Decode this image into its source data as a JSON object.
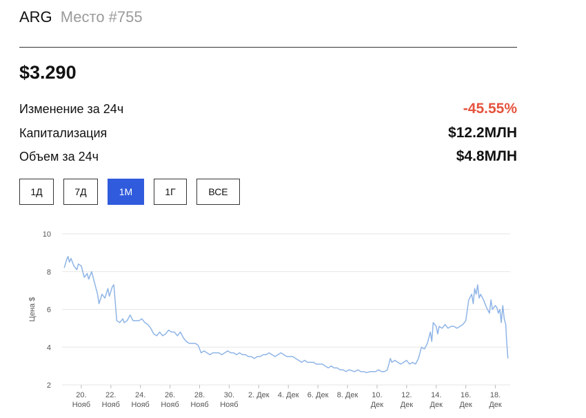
{
  "header": {
    "ticker": "ARG",
    "rank": "Место #755"
  },
  "price": "$3.290",
  "stats": [
    {
      "label": "Изменение за 24ч",
      "value": "-45.55%",
      "negative": true
    },
    {
      "label": "Капитализация",
      "value": "$12.2МЛН",
      "negative": false
    },
    {
      "label": "Объем за 24ч",
      "value": "$4.8МЛН",
      "negative": false
    }
  ],
  "periods": [
    {
      "label": "1Д",
      "active": false
    },
    {
      "label": "7Д",
      "active": false
    },
    {
      "label": "1М",
      "active": true
    },
    {
      "label": "1Г",
      "active": false
    },
    {
      "label": "ВСЕ",
      "active": false
    }
  ],
  "colors": {
    "accent": "#2f5bdc",
    "negative": "#e5533d",
    "line": "#8eb4e6"
  },
  "chart_data": {
    "type": "line",
    "ylabel": "Цена $",
    "ylim": [
      2,
      10
    ],
    "yticks": [
      2,
      4,
      6,
      8,
      10
    ],
    "xlim": [
      18.7,
      49.0
    ],
    "xticks": [
      {
        "x": 20,
        "l1": "20.",
        "l2": "Нояб"
      },
      {
        "x": 22,
        "l1": "22.",
        "l2": "Нояб"
      },
      {
        "x": 24,
        "l1": "24.",
        "l2": "Нояб"
      },
      {
        "x": 26,
        "l1": "26.",
        "l2": "Нояб"
      },
      {
        "x": 28,
        "l1": "28.",
        "l2": "Нояб"
      },
      {
        "x": 30,
        "l1": "30.",
        "l2": "Нояб"
      },
      {
        "x": 32,
        "l1": "2. Дек",
        "l2": ""
      },
      {
        "x": 34,
        "l1": "4. Дек",
        "l2": ""
      },
      {
        "x": 36,
        "l1": "6. Дек",
        "l2": ""
      },
      {
        "x": 38,
        "l1": "8. Дек",
        "l2": ""
      },
      {
        "x": 40,
        "l1": "10.",
        "l2": "Дек"
      },
      {
        "x": 42,
        "l1": "12.",
        "l2": "Дек"
      },
      {
        "x": 44,
        "l1": "14.",
        "l2": "Дек"
      },
      {
        "x": 46,
        "l1": "16.",
        "l2": "Дек"
      },
      {
        "x": 48,
        "l1": "18.",
        "l2": "Дек"
      }
    ],
    "series": [
      {
        "points": [
          [
            18.85,
            8.2
          ],
          [
            19.0,
            8.6
          ],
          [
            19.1,
            8.8
          ],
          [
            19.2,
            8.5
          ],
          [
            19.3,
            8.7
          ],
          [
            19.5,
            8.3
          ],
          [
            19.7,
            8.1
          ],
          [
            19.8,
            8.4
          ],
          [
            20.0,
            8.3
          ],
          [
            20.2,
            7.7
          ],
          [
            20.4,
            7.9
          ],
          [
            20.5,
            7.6
          ],
          [
            20.7,
            8.0
          ],
          [
            20.9,
            7.4
          ],
          [
            21.1,
            6.8
          ],
          [
            21.2,
            6.3
          ],
          [
            21.4,
            6.8
          ],
          [
            21.6,
            6.6
          ],
          [
            21.8,
            7.1
          ],
          [
            21.9,
            6.7
          ],
          [
            22.1,
            7.2
          ],
          [
            22.2,
            7.3
          ],
          [
            22.4,
            5.4
          ],
          [
            22.6,
            5.3
          ],
          [
            22.8,
            5.5
          ],
          [
            22.9,
            5.3
          ],
          [
            23.1,
            5.4
          ],
          [
            23.3,
            5.7
          ],
          [
            23.5,
            5.4
          ],
          [
            23.7,
            5.4
          ],
          [
            23.9,
            5.4
          ],
          [
            24.1,
            5.5
          ],
          [
            24.3,
            5.3
          ],
          [
            24.5,
            5.2
          ],
          [
            24.7,
            5.0
          ],
          [
            24.9,
            4.7
          ],
          [
            25.1,
            4.6
          ],
          [
            25.3,
            4.8
          ],
          [
            25.5,
            4.6
          ],
          [
            25.7,
            4.7
          ],
          [
            25.9,
            4.9
          ],
          [
            26.1,
            4.8
          ],
          [
            26.3,
            4.8
          ],
          [
            26.5,
            4.6
          ],
          [
            26.7,
            4.8
          ],
          [
            26.9,
            4.5
          ],
          [
            27.1,
            4.3
          ],
          [
            27.3,
            4.2
          ],
          [
            27.5,
            4.2
          ],
          [
            27.7,
            4.2
          ],
          [
            27.9,
            4.1
          ],
          [
            28.1,
            3.7
          ],
          [
            28.3,
            3.8
          ],
          [
            28.5,
            3.7
          ],
          [
            28.7,
            3.6
          ],
          [
            28.9,
            3.7
          ],
          [
            29.1,
            3.7
          ],
          [
            29.3,
            3.7
          ],
          [
            29.5,
            3.6
          ],
          [
            29.7,
            3.7
          ],
          [
            29.9,
            3.8
          ],
          [
            30.1,
            3.7
          ],
          [
            30.3,
            3.7
          ],
          [
            30.5,
            3.6
          ],
          [
            30.7,
            3.7
          ],
          [
            30.9,
            3.6
          ],
          [
            31.1,
            3.6
          ],
          [
            31.3,
            3.5
          ],
          [
            31.5,
            3.5
          ],
          [
            31.7,
            3.4
          ],
          [
            31.9,
            3.5
          ],
          [
            32.1,
            3.5
          ],
          [
            32.3,
            3.6
          ],
          [
            32.5,
            3.6
          ],
          [
            32.7,
            3.7
          ],
          [
            32.9,
            3.6
          ],
          [
            33.1,
            3.5
          ],
          [
            33.3,
            3.6
          ],
          [
            33.5,
            3.7
          ],
          [
            33.7,
            3.6
          ],
          [
            33.9,
            3.5
          ],
          [
            34.1,
            3.5
          ],
          [
            34.3,
            3.5
          ],
          [
            34.5,
            3.4
          ],
          [
            34.7,
            3.3
          ],
          [
            34.9,
            3.2
          ],
          [
            35.1,
            3.3
          ],
          [
            35.3,
            3.2
          ],
          [
            35.5,
            3.2
          ],
          [
            35.7,
            3.2
          ],
          [
            35.9,
            3.1
          ],
          [
            36.1,
            3.1
          ],
          [
            36.3,
            3.1
          ],
          [
            36.5,
            3.0
          ],
          [
            36.7,
            2.9
          ],
          [
            36.9,
            3.0
          ],
          [
            37.1,
            2.9
          ],
          [
            37.3,
            2.9
          ],
          [
            37.5,
            2.8
          ],
          [
            37.7,
            2.8
          ],
          [
            37.9,
            2.7
          ],
          [
            38.1,
            2.8
          ],
          [
            38.3,
            2.75
          ],
          [
            38.5,
            2.7
          ],
          [
            38.7,
            2.8
          ],
          [
            38.9,
            2.7
          ],
          [
            39.1,
            2.7
          ],
          [
            39.3,
            2.65
          ],
          [
            39.5,
            2.7
          ],
          [
            39.7,
            2.7
          ],
          [
            39.9,
            2.7
          ],
          [
            40.1,
            2.8
          ],
          [
            40.3,
            2.7
          ],
          [
            40.5,
            2.7
          ],
          [
            40.7,
            2.8
          ],
          [
            40.9,
            3.4
          ],
          [
            41.0,
            3.2
          ],
          [
            41.2,
            3.3
          ],
          [
            41.4,
            3.2
          ],
          [
            41.6,
            3.1
          ],
          [
            41.8,
            3.2
          ],
          [
            42.0,
            3.3
          ],
          [
            42.2,
            3.1
          ],
          [
            42.4,
            3.2
          ],
          [
            42.6,
            3.1
          ],
          [
            42.8,
            3.4
          ],
          [
            43.0,
            4.0
          ],
          [
            43.2,
            3.9
          ],
          [
            43.4,
            4.2
          ],
          [
            43.6,
            4.8
          ],
          [
            43.7,
            4.3
          ],
          [
            43.8,
            5.3
          ],
          [
            44.0,
            5.1
          ],
          [
            44.1,
            4.7
          ],
          [
            44.2,
            5.1
          ],
          [
            44.4,
            5.0
          ],
          [
            44.6,
            5.2
          ],
          [
            44.8,
            5.0
          ],
          [
            45.0,
            5.1
          ],
          [
            45.2,
            5.1
          ],
          [
            45.4,
            5.0
          ],
          [
            45.6,
            5.1
          ],
          [
            45.8,
            5.2
          ],
          [
            46.0,
            5.4
          ],
          [
            46.2,
            6.5
          ],
          [
            46.4,
            6.8
          ],
          [
            46.5,
            6.3
          ],
          [
            46.6,
            7.1
          ],
          [
            46.7,
            6.8
          ],
          [
            46.8,
            7.3
          ],
          [
            46.9,
            6.6
          ],
          [
            47.0,
            6.8
          ],
          [
            47.2,
            6.5
          ],
          [
            47.4,
            6.1
          ],
          [
            47.6,
            5.8
          ],
          [
            47.7,
            6.5
          ],
          [
            47.8,
            6.0
          ],
          [
            48.0,
            6.2
          ],
          [
            48.1,
            6.1
          ],
          [
            48.2,
            5.8
          ],
          [
            48.3,
            6.0
          ],
          [
            48.4,
            5.3
          ],
          [
            48.5,
            6.2
          ],
          [
            48.6,
            5.5
          ],
          [
            48.7,
            5.2
          ],
          [
            48.75,
            4.5
          ],
          [
            48.8,
            3.9
          ],
          [
            48.85,
            3.4
          ]
        ]
      }
    ]
  }
}
